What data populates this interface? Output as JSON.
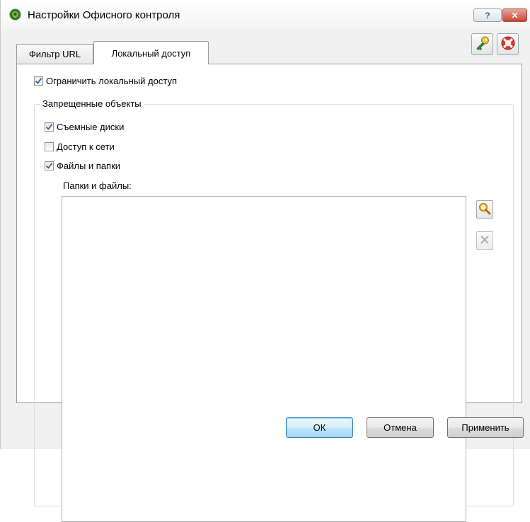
{
  "window": {
    "title": "Настройки Офисного контроля",
    "help_label": "?",
    "close_label": "✕"
  },
  "tabs": [
    {
      "label": "Фильтр URL",
      "active": false
    },
    {
      "label": "Локальный доступ",
      "active": true
    }
  ],
  "toolbar": {
    "key_icon": "key-icon",
    "help_icon": "lifebuoy-icon"
  },
  "restrict": {
    "label": "Ограничить локальный доступ",
    "checked": true
  },
  "group": {
    "title": "Запрещенные объекты",
    "items": [
      {
        "label": "Съемные диски",
        "checked": true
      },
      {
        "label": "Доступ к сети",
        "checked": false
      },
      {
        "label": "Файлы и папки",
        "checked": true
      }
    ],
    "list_label": "Папки и файлы:",
    "list_items": []
  },
  "buttons": {
    "ok": "ОК",
    "cancel": "Отмена",
    "apply": "Применить"
  },
  "colors": {
    "accent": "#3c7fb1",
    "close_button": "#c9432f",
    "check_mark": "#3a5a9c"
  }
}
